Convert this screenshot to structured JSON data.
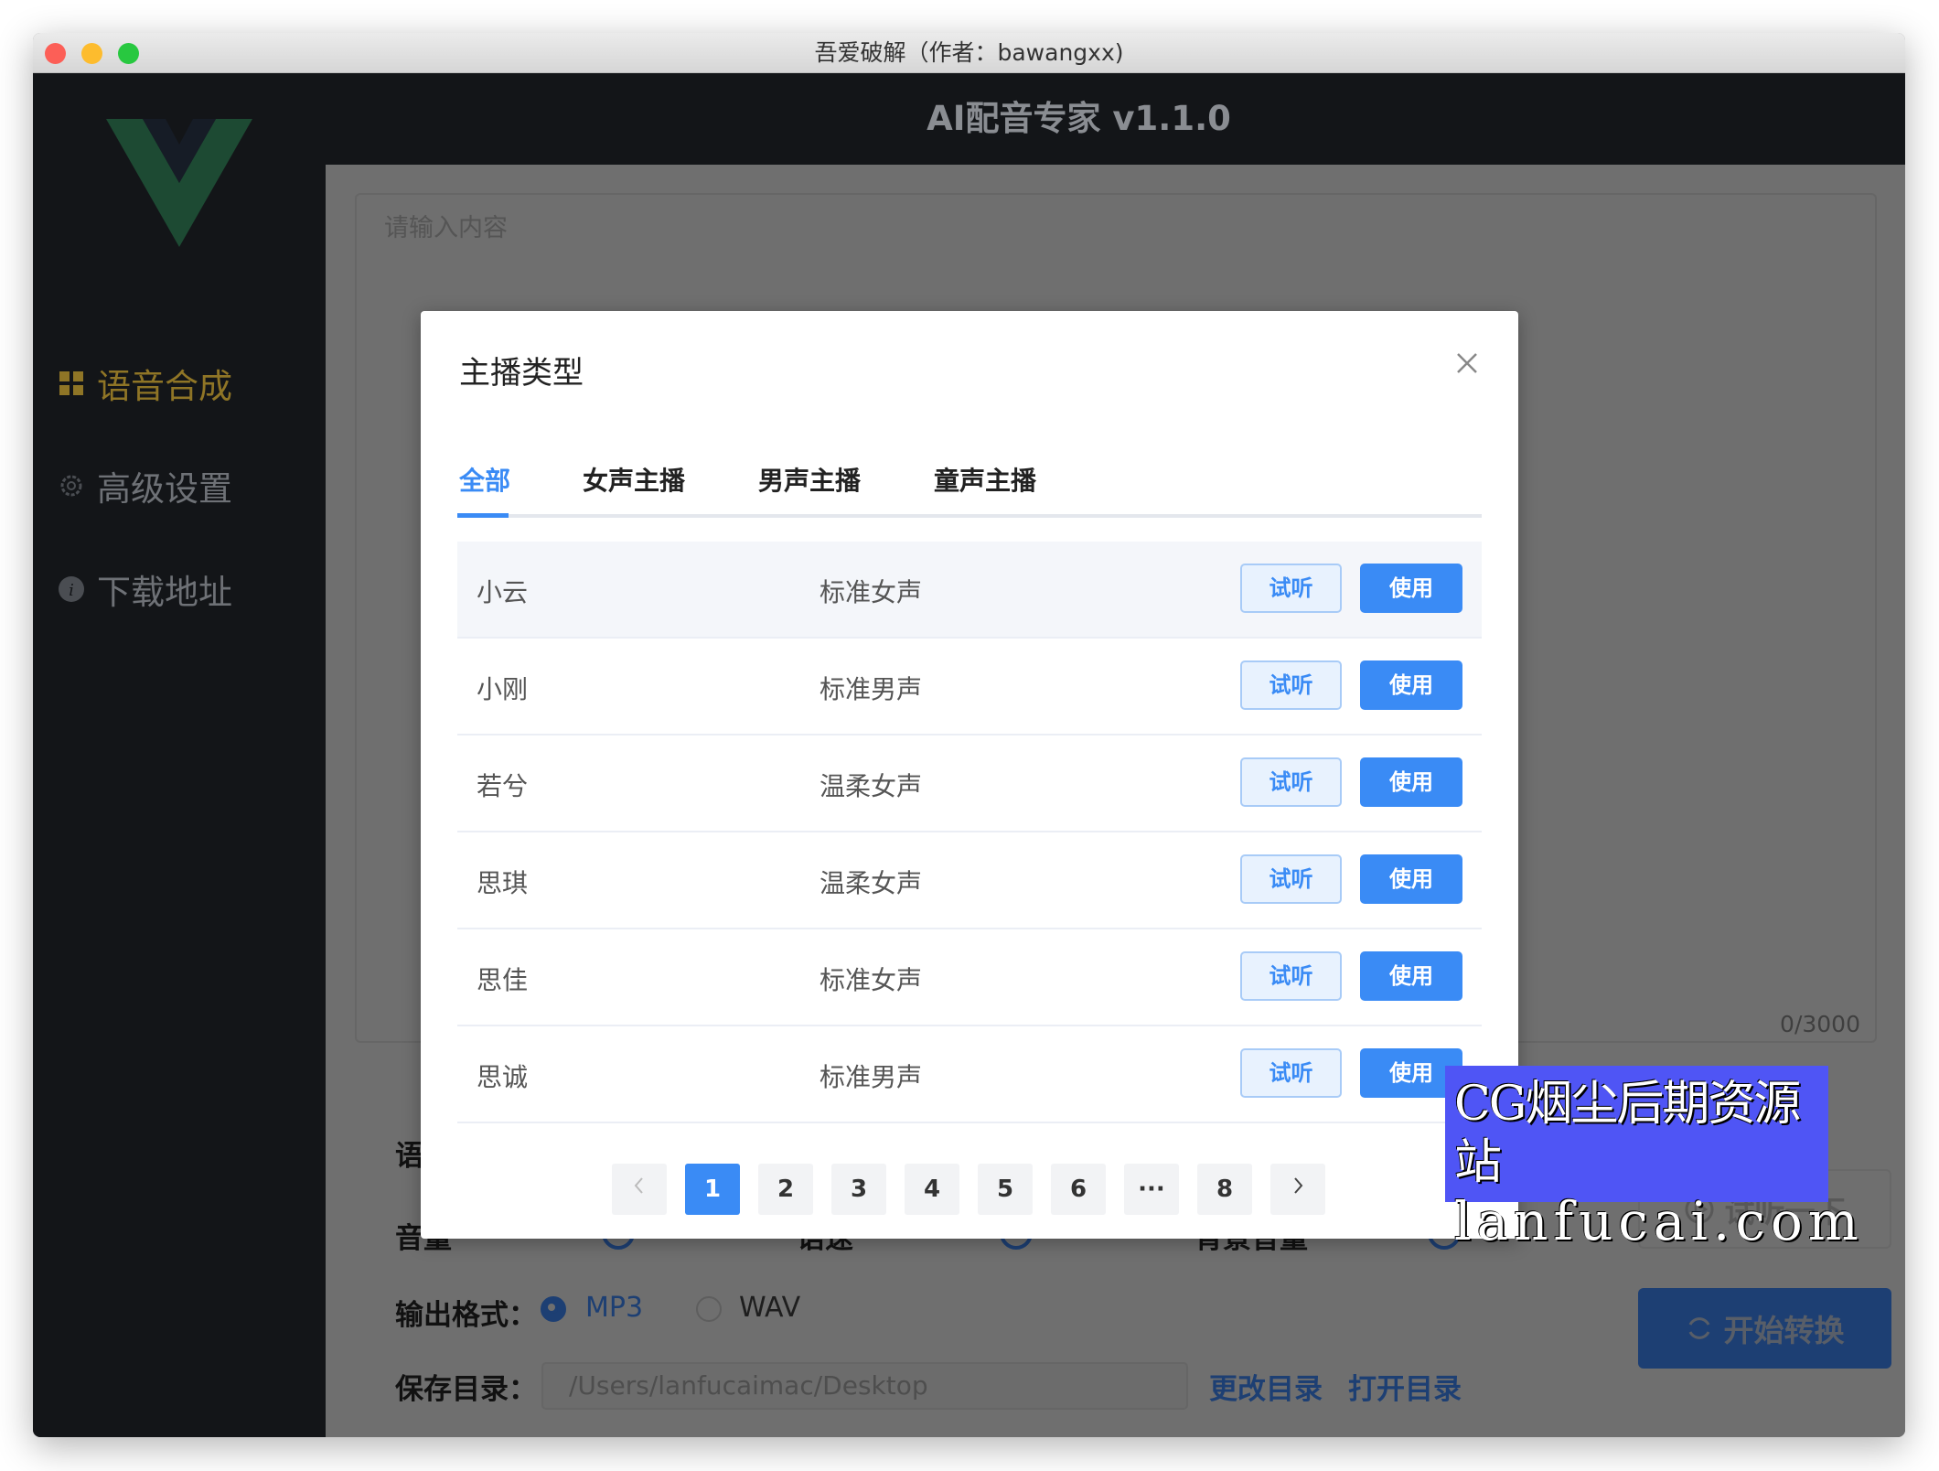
{
  "window": {
    "title": "吾爱破解（作者：bawangxx)"
  },
  "header": {
    "title": "AI配音专家 v1.1.0"
  },
  "sidebar": {
    "items": [
      {
        "label": "语音合成",
        "icon": "grid-icon",
        "active": true
      },
      {
        "label": "高级设置",
        "icon": "gear-icon"
      },
      {
        "label": "下载地址",
        "icon": "info-icon"
      }
    ]
  },
  "main": {
    "text_placeholder": "请输入内容",
    "char_count": "0/3000",
    "voice_label": "语音",
    "volume_label": "音量",
    "speed_label": "语速",
    "bg_volume_label": "背景音量",
    "format_label": "输出格式：",
    "formats": [
      {
        "label": "MP3",
        "selected": true
      },
      {
        "label": "WAV",
        "selected": false
      }
    ],
    "save_label": "保存目录：",
    "save_path": "/Users/lanfucaimac/Desktop",
    "change_dir": "更改目录",
    "open_dir": "打开目录",
    "preview_button": "试听一下",
    "convert_button": "开始转换"
  },
  "dialog": {
    "title": "主播类型",
    "tabs": [
      "全部",
      "女声主播",
      "男声主播",
      "童声主播"
    ],
    "active_tab": 0,
    "rows": [
      {
        "name": "小云",
        "type": "标准女声"
      },
      {
        "name": "小刚",
        "type": "标准男声"
      },
      {
        "name": "若兮",
        "type": "温柔女声"
      },
      {
        "name": "思琪",
        "type": "温柔女声"
      },
      {
        "name": "思佳",
        "type": "标准女声"
      },
      {
        "name": "思诚",
        "type": "标准男声"
      }
    ],
    "listen_label": "试听",
    "use_label": "使用",
    "pages": [
      "1",
      "2",
      "3",
      "4",
      "5",
      "6",
      "···",
      "8"
    ],
    "current_page": 1
  },
  "watermark": {
    "line1": "CG烟尘后期资源站",
    "line2": "lanfucai.com"
  },
  "colors": {
    "primary": "#3a8bf5",
    "accent": "#c9a227",
    "sidebar": "#131518"
  }
}
